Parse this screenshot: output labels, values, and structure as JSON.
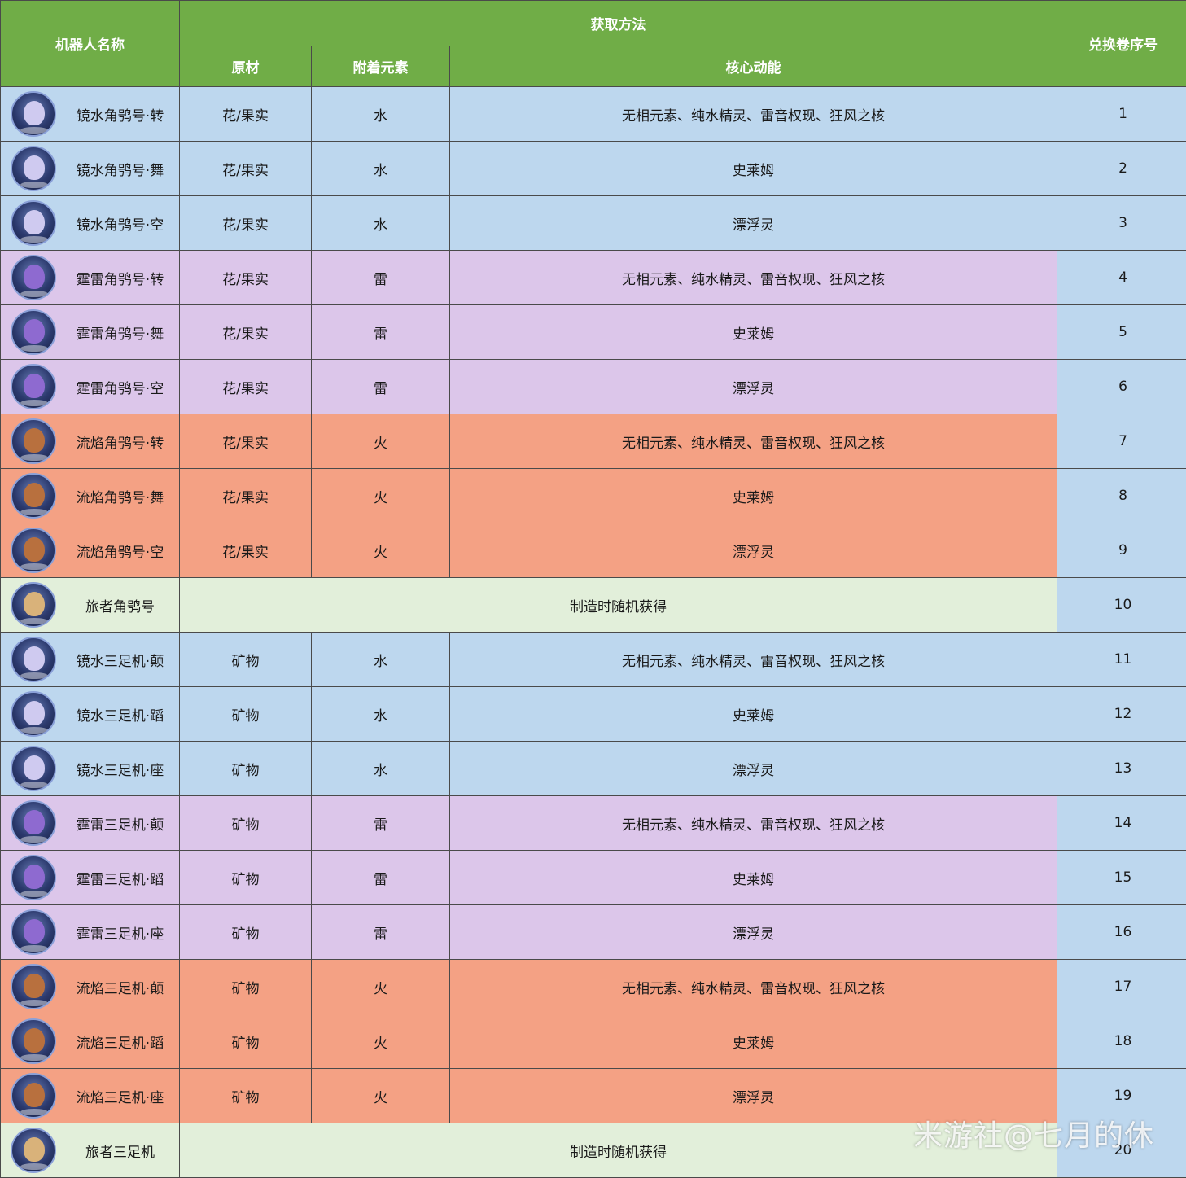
{
  "header": {
    "name_col": "机器人名称",
    "method_group": "获取方法",
    "material_col": "原材",
    "element_col": "附着元素",
    "core_col": "核心动能",
    "scroll_col": "兑换卷序号"
  },
  "rows": [
    {
      "name": "镜水角鸮号·转",
      "material": "花/果实",
      "element": "水",
      "core": "无相元素、纯水精灵、雷音权现、狂风之核",
      "num": "1",
      "theme": "water",
      "icon": "water-owl-robot-icon"
    },
    {
      "name": "镜水角鸮号·舞",
      "material": "花/果实",
      "element": "水",
      "core": "史莱姆",
      "num": "2",
      "theme": "water",
      "icon": "water-owl-robot-icon"
    },
    {
      "name": "镜水角鸮号·空",
      "material": "花/果实",
      "element": "水",
      "core": "漂浮灵",
      "num": "3",
      "theme": "water",
      "icon": "water-owl-robot-icon"
    },
    {
      "name": "霆雷角鸮号·转",
      "material": "花/果实",
      "element": "雷",
      "core": "无相元素、纯水精灵、雷音权现、狂风之核",
      "num": "4",
      "theme": "thunder",
      "icon": "thunder-owl-robot-icon"
    },
    {
      "name": "霆雷角鸮号·舞",
      "material": "花/果实",
      "element": "雷",
      "core": "史莱姆",
      "num": "5",
      "theme": "thunder",
      "icon": "thunder-owl-robot-icon"
    },
    {
      "name": "霆雷角鸮号·空",
      "material": "花/果实",
      "element": "雷",
      "core": "漂浮灵",
      "num": "6",
      "theme": "thunder",
      "icon": "thunder-owl-robot-icon"
    },
    {
      "name": "流焰角鸮号·转",
      "material": "花/果实",
      "element": "火",
      "core": "无相元素、纯水精灵、雷音权现、狂风之核",
      "num": "7",
      "theme": "fire",
      "icon": "fire-owl-robot-icon"
    },
    {
      "name": "流焰角鸮号·舞",
      "material": "花/果实",
      "element": "火",
      "core": "史莱姆",
      "num": "8",
      "theme": "fire",
      "icon": "fire-owl-robot-icon"
    },
    {
      "name": "流焰角鸮号·空",
      "material": "花/果实",
      "element": "火",
      "core": "漂浮灵",
      "num": "9",
      "theme": "fire",
      "icon": "fire-owl-robot-icon"
    },
    {
      "name": "旅者角鸮号",
      "merged": "制造时随机获得",
      "num": "10",
      "theme": "trav",
      "icon": "traveler-owl-robot-icon"
    },
    {
      "name": "镜水三足机·颠",
      "material": "矿物",
      "element": "水",
      "core": "无相元素、纯水精灵、雷音权现、狂风之核",
      "num": "11",
      "theme": "water",
      "icon": "water-tripod-robot-icon"
    },
    {
      "name": "镜水三足机·蹈",
      "material": "矿物",
      "element": "水",
      "core": "史莱姆",
      "num": "12",
      "theme": "water",
      "icon": "water-tripod-robot-icon"
    },
    {
      "name": "镜水三足机·座",
      "material": "矿物",
      "element": "水",
      "core": "漂浮灵",
      "num": "13",
      "theme": "water",
      "icon": "water-tripod-robot-icon"
    },
    {
      "name": "霆雷三足机·颠",
      "material": "矿物",
      "element": "雷",
      "core": "无相元素、纯水精灵、雷音权现、狂风之核",
      "num": "14",
      "theme": "thunder",
      "icon": "thunder-tripod-robot-icon"
    },
    {
      "name": "霆雷三足机·蹈",
      "material": "矿物",
      "element": "雷",
      "core": "史莱姆",
      "num": "15",
      "theme": "thunder",
      "icon": "thunder-tripod-robot-icon"
    },
    {
      "name": "霆雷三足机·座",
      "material": "矿物",
      "element": "雷",
      "core": "漂浮灵",
      "num": "16",
      "theme": "thunder",
      "icon": "thunder-tripod-robot-icon"
    },
    {
      "name": "流焰三足机·颠",
      "material": "矿物",
      "element": "火",
      "core": "无相元素、纯水精灵、雷音权现、狂风之核",
      "num": "17",
      "theme": "fire",
      "icon": "fire-tripod-robot-icon"
    },
    {
      "name": "流焰三足机·蹈",
      "material": "矿物",
      "element": "火",
      "core": "史莱姆",
      "num": "18",
      "theme": "fire",
      "icon": "fire-tripod-robot-icon"
    },
    {
      "name": "流焰三足机·座",
      "material": "矿物",
      "element": "火",
      "core": "漂浮灵",
      "num": "19",
      "theme": "fire",
      "icon": "fire-tripod-robot-icon"
    },
    {
      "name": "旅者三足机",
      "merged": "制造时随机获得",
      "num": "20",
      "theme": "trav",
      "icon": "traveler-tripod-robot-icon"
    }
  ],
  "watermark": "米游社@七月的休",
  "colors": {
    "header": "#70ad47",
    "water": "#bdd7ee",
    "thunder": "#dcc6ea",
    "fire": "#f4a184",
    "traveler": "#e2efda",
    "number_column": "#bdd7ee"
  }
}
